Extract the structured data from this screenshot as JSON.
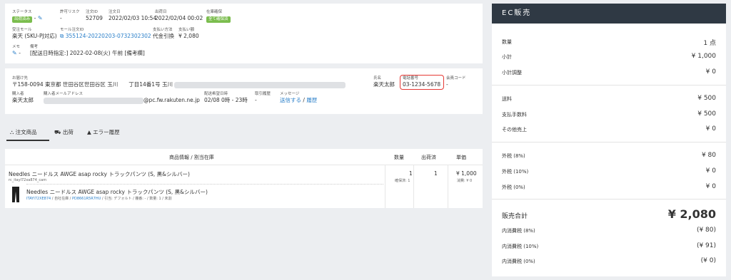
{
  "order": {
    "status_label": "ステータス",
    "status_badge": "出荷済み",
    "status_dash": "-",
    "permit_risk_label": "許可リスク",
    "permit_risk_value": "-",
    "order_id_label": "注文ID",
    "order_id": "52709",
    "order_date_label": "注文日",
    "order_date": "2022/02/03 10:54",
    "ship_date_label": "出荷日",
    "ship_date": "2022/02/04 00:02",
    "stock_label": "在庫確保",
    "stock_badge": "全て確保済",
    "receive_mall_label": "受注モール",
    "receive_mall": "楽天 (SKU-PJ対応)",
    "mall_order_id_label": "モール注文ID",
    "mall_order_id": "355124-20220203-0732302302",
    "pay_method_label": "支払い方法",
    "pay_method": "代金引換",
    "pay_amount_label": "支払い額",
    "pay_amount": "¥ 2,080",
    "memo_label": "メモ",
    "memo_value": "-",
    "remarks_label": "備考",
    "remarks_value": "[配送日時指定:] 2022-02-08(火) 午前 [備考欄]"
  },
  "customer": {
    "address_label": "お届け先",
    "address_value": "〒158-0094 東京都 世田谷区世田谷区 玉川　　丁目14番1号 玉川",
    "name_label": "氏名",
    "name_value": "楽天太郎",
    "phone_label": "電話番号",
    "phone_value": "03-1234-5678",
    "member_code_label": "会員コード",
    "member_code_value": "-",
    "buyer_label": "購入者",
    "buyer_value": "楽天太郎",
    "buyer_email_label": "購入者メールアドレス",
    "buyer_email_value": "@pc.fw.rakuten.ne.jp",
    "delivery_time_label": "配送希望日時",
    "delivery_time_value": "02/08 0時 - 23時",
    "history_label": "取引履歴",
    "history_value": "-",
    "message_label": "メッセージ",
    "message_send": "送信する",
    "message_sep": "/",
    "message_history": "履歴"
  },
  "tabs": [
    {
      "label": "注文商品",
      "icon": "products-icon"
    },
    {
      "label": "出荷",
      "icon": "truck-icon"
    },
    {
      "label": "エラー履歴",
      "icon": "warning-icon"
    }
  ],
  "table": {
    "col_product": "商品情報 / 割当在庫",
    "col_qty": "数量",
    "col_shipped": "出荷済",
    "col_price": "単価",
    "item_name": "Needles ニードルス AWGE asap rocky トラックパンツ (S, 黒&シルバー)",
    "item_code": "rc_itayl72xa874_cam",
    "qty": "1",
    "qty_sub": "確保済: 1",
    "shipped": "1",
    "price": "¥ 1,000",
    "price_sub": "消費: ¥ 0",
    "sub_name": "Needles ニードルス AWGE asap rocky トラックパンツ (S, 黒&シルバー)",
    "sub_code1": "ITAYI72XE874",
    "sub_sep1": "/ 自社在庫 /",
    "sub_code2": "PD8661R5R7HU",
    "sub_meta": "/ 引当: デフォルト / 棚番: - / 数量: 1 / 未割"
  },
  "ec": {
    "title": "EC販売",
    "qty_label": "数量",
    "qty_value": "1 点",
    "subtotal_label": "小計",
    "subtotal_value": "¥ 1,000",
    "subtotal_adj_label": "小計調整",
    "subtotal_adj_value": "¥ 0",
    "shipping_label": "送料",
    "shipping_value": "¥ 500",
    "fee_label": "支払手数料",
    "fee_value": "¥ 500",
    "other_label": "その他売上",
    "other_value": "¥ 0",
    "tax8_label": "外税 (8%)",
    "tax8_value": "¥ 80",
    "tax10_label": "外税 (10%)",
    "tax10_value": "¥ 0",
    "tax0_label": "外税 (0%)",
    "tax0_value": "¥ 0",
    "total_label": "販売合計",
    "total_value": "¥ 2,080",
    "in8_label": "内消費税 (8%)",
    "in8_value": "(¥ 80)",
    "in10_label": "内消費税 (10%)",
    "in10_value": "(¥ 91)",
    "in0_label": "内消費税 (0%)",
    "in0_value": "(¥ 0)"
  },
  "colors": {
    "accent": "#2a7fc9",
    "badge_green": "#7bbd4e",
    "dark_header": "#2f3944",
    "highlight_red": "#e53935"
  }
}
